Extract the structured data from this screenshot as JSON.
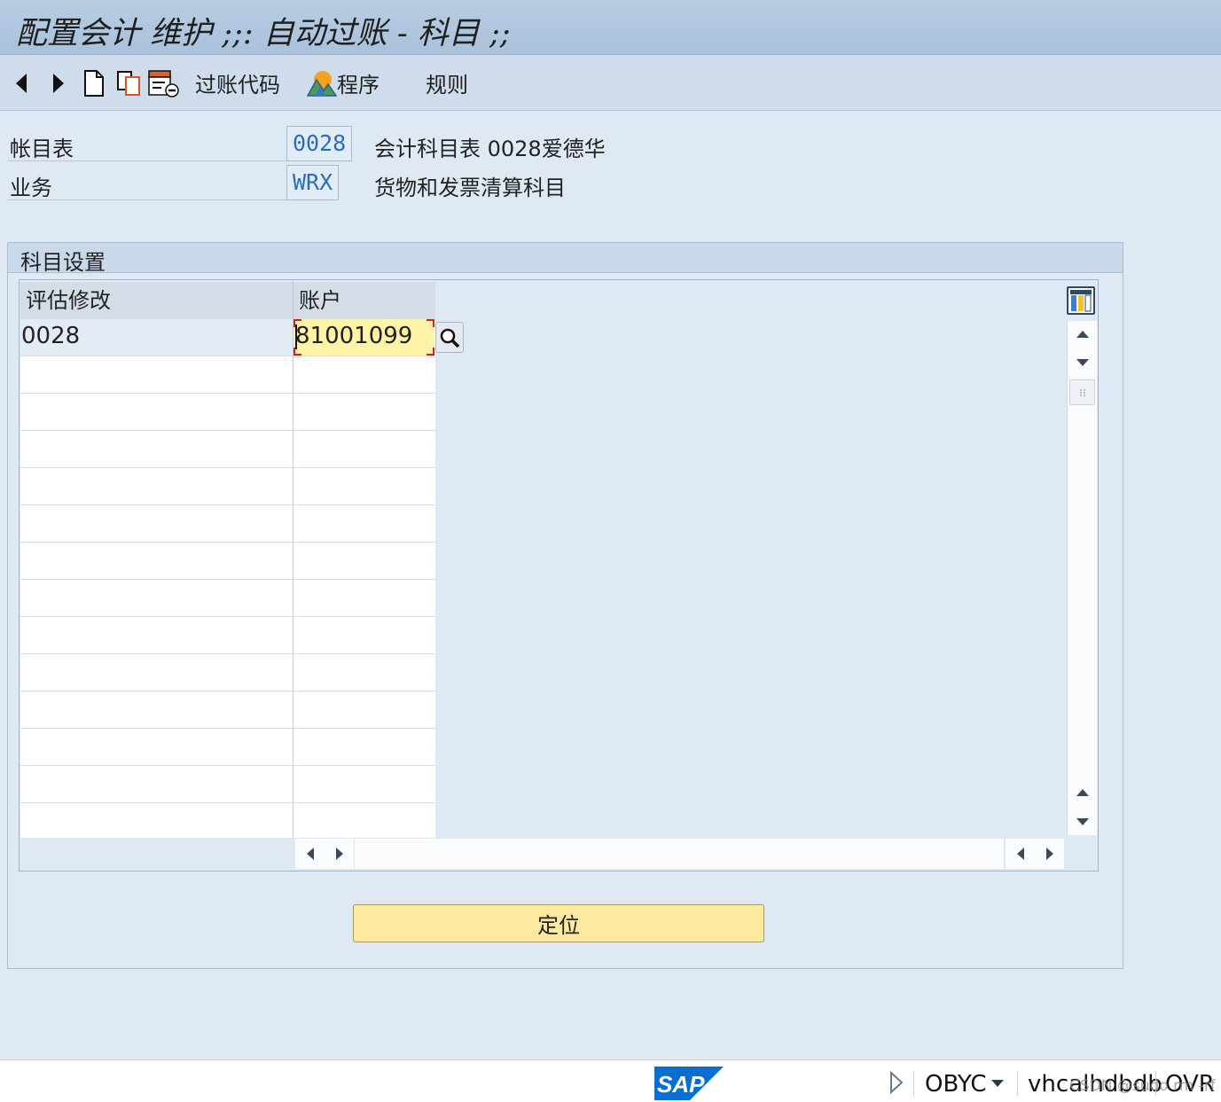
{
  "window": {
    "title": "配置会计 维护 ;;: 自动过账 - 科目 ;;"
  },
  "toolbar": {
    "back_icon": "triangle-left-icon",
    "forward_icon": "triangle-right-icon",
    "new_icon": "new-document-icon",
    "copy_icon": "copy-icon",
    "delete_icon": "delete-entry-icon",
    "posting_key_label": "过账代码",
    "procedure_label": "程序",
    "rules_label": "规则"
  },
  "header": {
    "chart_of_accounts": {
      "label": "帐目表",
      "value": "0028",
      "description": "会计科目表 0028爱德华"
    },
    "transaction": {
      "label": "业务",
      "value": "WRX",
      "description": "货物和发票清算科目"
    }
  },
  "account_assignment": {
    "title": "科目设置",
    "columns": [
      "评估修改",
      "账户"
    ],
    "rows": [
      {
        "valuation_modif": "0028",
        "account": "81001099"
      }
    ]
  },
  "buttons": {
    "position_label": "定位"
  },
  "statusbar": {
    "transaction_code": "OBYC",
    "system": "vhcalhdbdb",
    "mode": "OVR",
    "watermark": "CSDN @sudo rm -rf"
  },
  "colors": {
    "title_bar": "#b7cde3",
    "toolbar": "#cfdceb",
    "input_highlight": "#fff3a8",
    "field_value_text": "#2a6ebb",
    "button_yellow": "#ffe9a0",
    "sap_blue": "#0a6ed1"
  }
}
